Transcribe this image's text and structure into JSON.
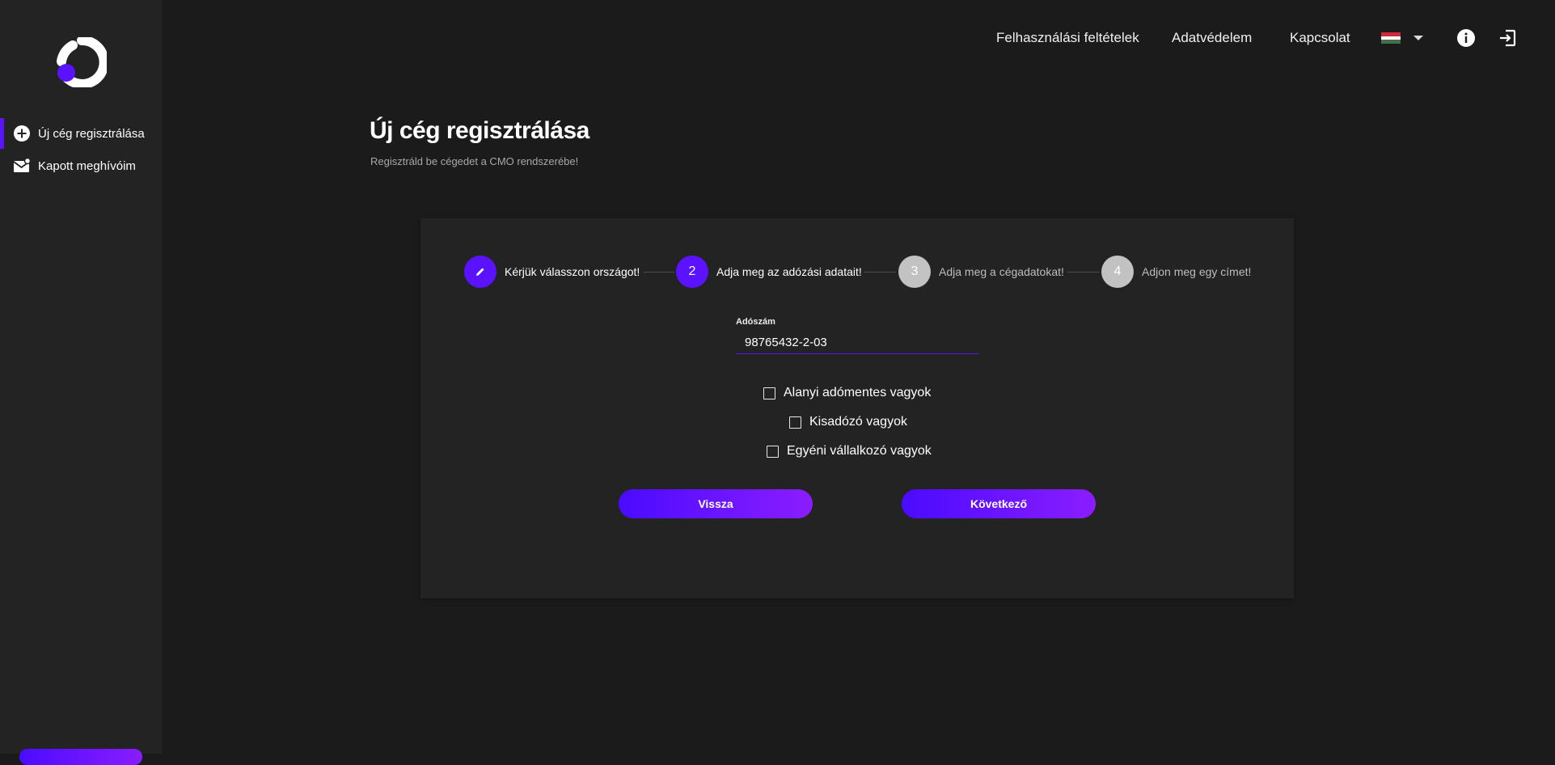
{
  "sidebar": {
    "items": [
      {
        "label": "Új cég regisztrálása",
        "icon": "add-circle-icon",
        "active": true
      },
      {
        "label": "Kapott meghívóim",
        "icon": "mail-notification-icon",
        "active": false
      }
    ]
  },
  "topnav": {
    "terms": "Felhasználási feltételek",
    "privacy": "Adatvédelem",
    "contact": "Kapcsolat",
    "language_flag": "hungarian-flag-icon"
  },
  "page": {
    "title": "Új cég regisztrálása",
    "subtitle": "Regisztráld be cégedet a CMO rendszerébe!"
  },
  "stepper": {
    "steps": [
      {
        "label": "Kérjük válasszon országot!",
        "marker": "",
        "state": "done"
      },
      {
        "label": "Adja meg az adózási adatait!",
        "marker": "2",
        "state": "active"
      },
      {
        "label": "Adja meg a cégadatokat!",
        "marker": "3",
        "state": "inactive"
      },
      {
        "label": "Adjon meg egy címet!",
        "marker": "4",
        "state": "inactive"
      }
    ]
  },
  "form": {
    "tax_number_label": "Adószám",
    "tax_number_value": "98765432-2-03",
    "checkboxes": [
      {
        "label": "Alanyi adómentes vagyok",
        "checked": false
      },
      {
        "label": "Kisadózó vagyok",
        "checked": false
      },
      {
        "label": "Egyéni vállalkozó vagyok",
        "checked": false
      }
    ],
    "back_label": "Vissza",
    "next_label": "Következő"
  },
  "colors": {
    "accent": "#5a12ff",
    "accent_gradient_end": "#8b1dff",
    "background": "#1b1b1b",
    "panel": "#232323"
  }
}
